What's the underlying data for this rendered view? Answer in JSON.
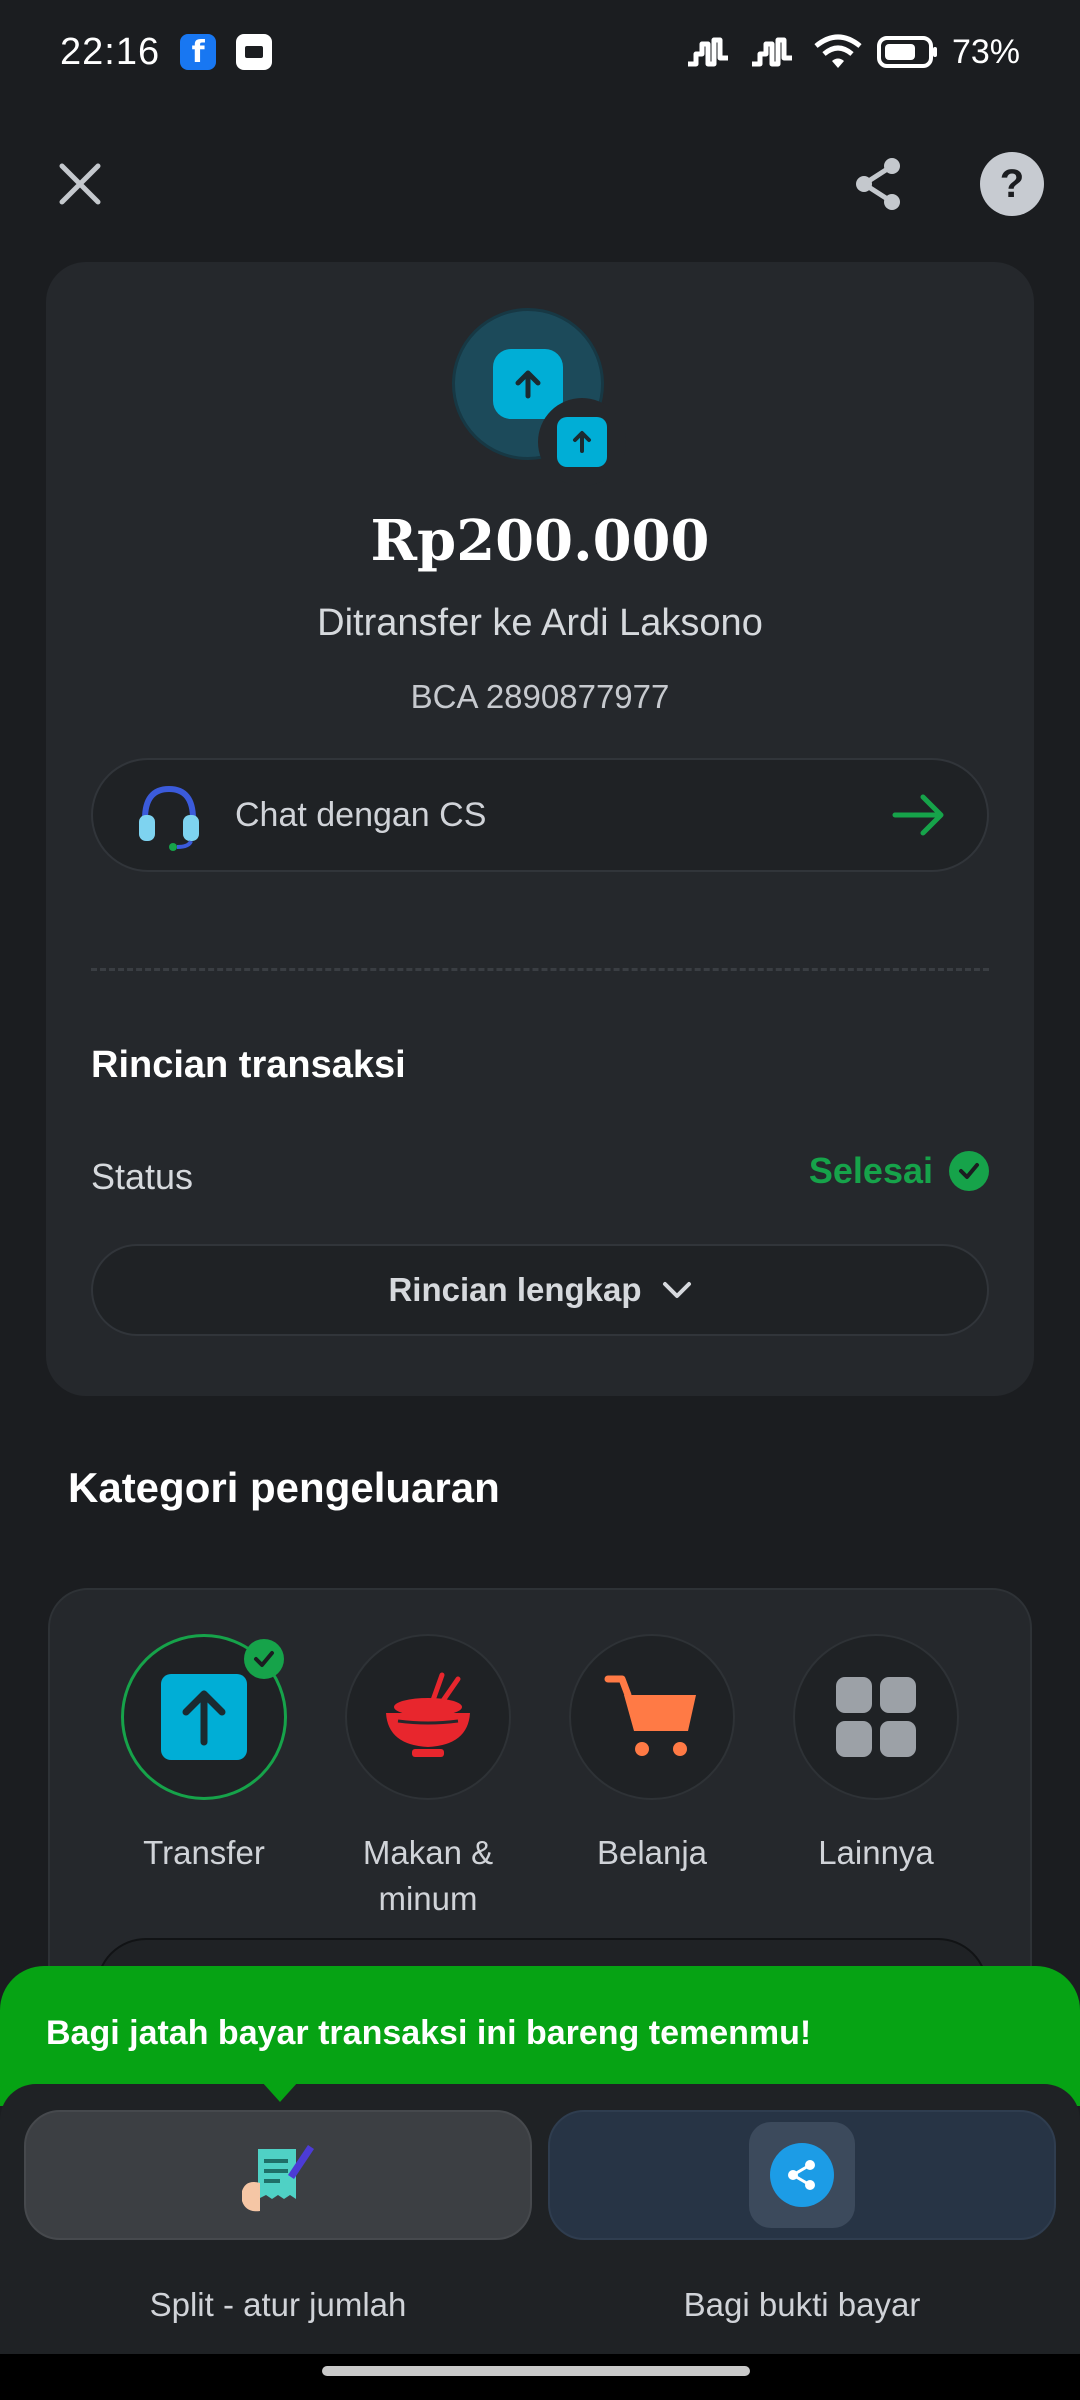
{
  "status_bar": {
    "time": "22:16",
    "facebook_glyph": "f",
    "battery": "73%",
    "icons": [
      "facebook-icon",
      "screen-icon",
      "signal-icon",
      "signal-icon",
      "wifi-icon",
      "battery-icon"
    ]
  },
  "top_bar": {
    "icons": [
      "close-icon",
      "share-icon",
      "help-icon"
    ],
    "help_glyph": "?"
  },
  "transaction": {
    "amount": "Rp200.000",
    "recipient": "Ditransfer ke Ardi Laksono",
    "account": "BCA 2890877977",
    "cs_label": "Chat dengan CS"
  },
  "details": {
    "title": "Rincian transaksi",
    "status_label": "Status",
    "status_value": "Selesai",
    "full_details_label": "Rincian lengkap"
  },
  "category": {
    "title": "Kategori pengeluaran",
    "items": [
      {
        "label": "Transfer",
        "icon": "transfer-icon",
        "selected": true
      },
      {
        "label": "Makan & minum",
        "icon": "food-bowl-icon",
        "selected": false
      },
      {
        "label": "Belanja",
        "icon": "shopping-cart-icon",
        "selected": false
      },
      {
        "label": "Lainnya",
        "icon": "grid-icon",
        "selected": false
      }
    ]
  },
  "promo": {
    "text": "Bagi jatah bayar transaksi ini bareng temenmu!"
  },
  "actions": {
    "split_label": "Split - atur jumlah",
    "share_label": "Bagi bukti bayar"
  },
  "colors": {
    "background": "#1b1d20",
    "card": "#25282c",
    "accent_green": "#16a34a",
    "promo_green": "#06a314",
    "transfer_blue": "#00aed6",
    "food_red": "#e8262d",
    "cart_orange": "#ff7a45"
  }
}
